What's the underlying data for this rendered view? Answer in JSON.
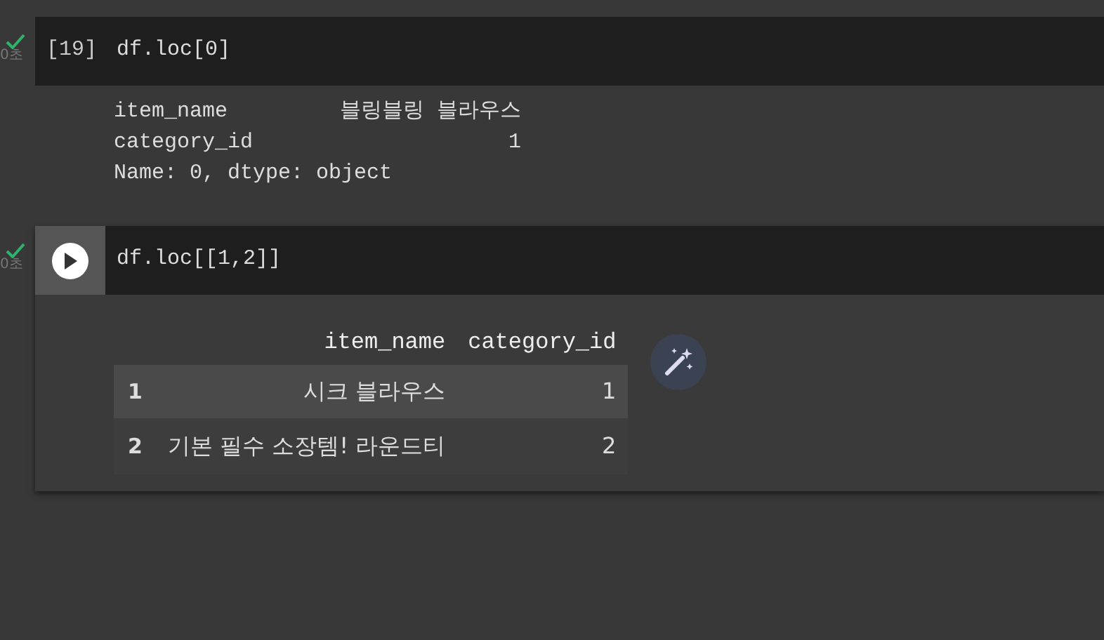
{
  "cells": [
    {
      "exec_count": "[19]",
      "time": "0초",
      "done": true,
      "code": "df.loc[0]",
      "kind": "text",
      "output_lines": [
        [
          "item_name",
          "블링블링 블라우스"
        ],
        [
          "category_id",
          "1"
        ]
      ],
      "output_footer": "Name: 0, dtype: object"
    },
    {
      "time": "0초",
      "done": true,
      "code": "df.loc[[1,2]]",
      "kind": "table",
      "table": {
        "columns": [
          "item_name",
          "category_id"
        ],
        "rows": [
          {
            "index": "1",
            "cells": [
              "시크 블라우스",
              "1"
            ],
            "selected": true
          },
          {
            "index": "2",
            "cells": [
              "기본 필수 소장템! 라운드티",
              "2"
            ],
            "selected": false
          }
        ]
      }
    }
  ]
}
